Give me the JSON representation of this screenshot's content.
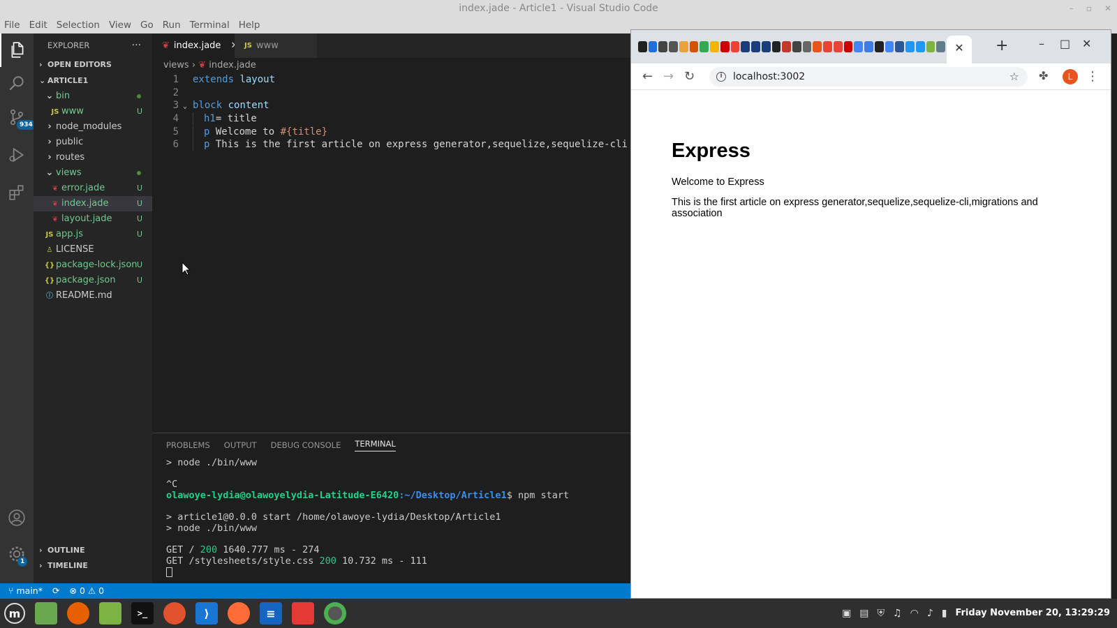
{
  "window": {
    "title": "index.jade - Article1 - Visual Studio Code"
  },
  "menu": [
    "File",
    "Edit",
    "Selection",
    "View",
    "Go",
    "Run",
    "Terminal",
    "Help"
  ],
  "activity": {
    "items": [
      "files-icon",
      "search-icon",
      "source-control-icon",
      "run-debug-icon",
      "extensions-icon",
      "account-icon",
      "settings-gear-icon"
    ],
    "scm_badge": "934",
    "settings_badge": "1"
  },
  "explorer": {
    "title": "EXPLORER",
    "more": "···",
    "open_editors": "OPEN EDITORS",
    "project": "ARTICLE1",
    "tree": [
      {
        "label": "bin",
        "kind": "folder-open",
        "indent": 1,
        "status": "dot"
      },
      {
        "label": "www",
        "kind": "js",
        "indent": 2,
        "status": "U"
      },
      {
        "label": "node_modules",
        "kind": "folder",
        "indent": 1,
        "status": ""
      },
      {
        "label": "public",
        "kind": "folder",
        "indent": 1,
        "status": ""
      },
      {
        "label": "routes",
        "kind": "folder",
        "indent": 1,
        "status": ""
      },
      {
        "label": "views",
        "kind": "folder-open",
        "indent": 1,
        "status": "dot"
      },
      {
        "label": "error.jade",
        "kind": "jade",
        "indent": 2,
        "status": "U"
      },
      {
        "label": "index.jade",
        "kind": "jade",
        "indent": 2,
        "status": "U",
        "selected": true
      },
      {
        "label": "layout.jade",
        "kind": "jade",
        "indent": 2,
        "status": "U"
      },
      {
        "label": "app.js",
        "kind": "js",
        "indent": 1,
        "status": "U"
      },
      {
        "label": "LICENSE",
        "kind": "license",
        "indent": 1,
        "status": ""
      },
      {
        "label": "package-lock.json",
        "kind": "json",
        "indent": 1,
        "status": "U"
      },
      {
        "label": "package.json",
        "kind": "json",
        "indent": 1,
        "status": "U"
      },
      {
        "label": "README.md",
        "kind": "info",
        "indent": 1,
        "status": ""
      }
    ],
    "outline": "OUTLINE",
    "timeline": "TIMELINE"
  },
  "editor": {
    "tabs": [
      {
        "label": "index.jade",
        "icon": "jade-icon",
        "active": true
      },
      {
        "label": "www",
        "icon": "js-icon",
        "active": false
      }
    ],
    "breadcrumb": {
      "folder": "views",
      "file": "index.jade"
    },
    "lines": [
      {
        "n": "1",
        "a": "extends",
        "b": " layout",
        "c": ""
      },
      {
        "n": "2",
        "a": "",
        "b": "",
        "c": ""
      },
      {
        "n": "3",
        "a": "block",
        "b": " content",
        "c": ""
      },
      {
        "n": "4",
        "a": "h1",
        "b": "= title",
        "c": ""
      },
      {
        "n": "5",
        "a": "p",
        "b": " Welcome to ",
        "c": "#{title}"
      },
      {
        "n": "6",
        "a": "p",
        "b": " This is the first article on express generator,sequelize,sequelize-cli",
        "c": ""
      }
    ]
  },
  "panel": {
    "tabs": [
      "PROBLEMS",
      "OUTPUT",
      "DEBUG CONSOLE",
      "TERMINAL"
    ],
    "terminal": {
      "l1": "> node ./bin/www",
      "l2": "^C",
      "prompt_user": "olawoye-lydia@olawoyelydia-Latitude-E6420",
      "prompt_path": ":~/Desktop/Article1",
      "prompt_cmd": "$ npm start",
      "l4": "> article1@0.0.0 start /home/olawoye-lydia/Desktop/Article1",
      "l5": "> node ./bin/www",
      "get1_a": "GET / ",
      "get1_code": "200",
      "get1_b": " 1640.777 ms - 274",
      "get2_a": "GET /stylesheets/style.css ",
      "get2_code": "200",
      "get2_b": " 10.732 ms - 111"
    }
  },
  "statusbar": {
    "branch": "main*",
    "errors": "0",
    "warnings": "0"
  },
  "chrome": {
    "url": "localhost:3002",
    "avatar": "L",
    "page": {
      "h1": "Express",
      "p1": "Welcome to Express",
      "p2": "This is the first article on express generator,sequelize,sequelize-cli,migrations and association"
    }
  },
  "taskbar": {
    "clock": "Friday November 20, 13:29:29"
  }
}
